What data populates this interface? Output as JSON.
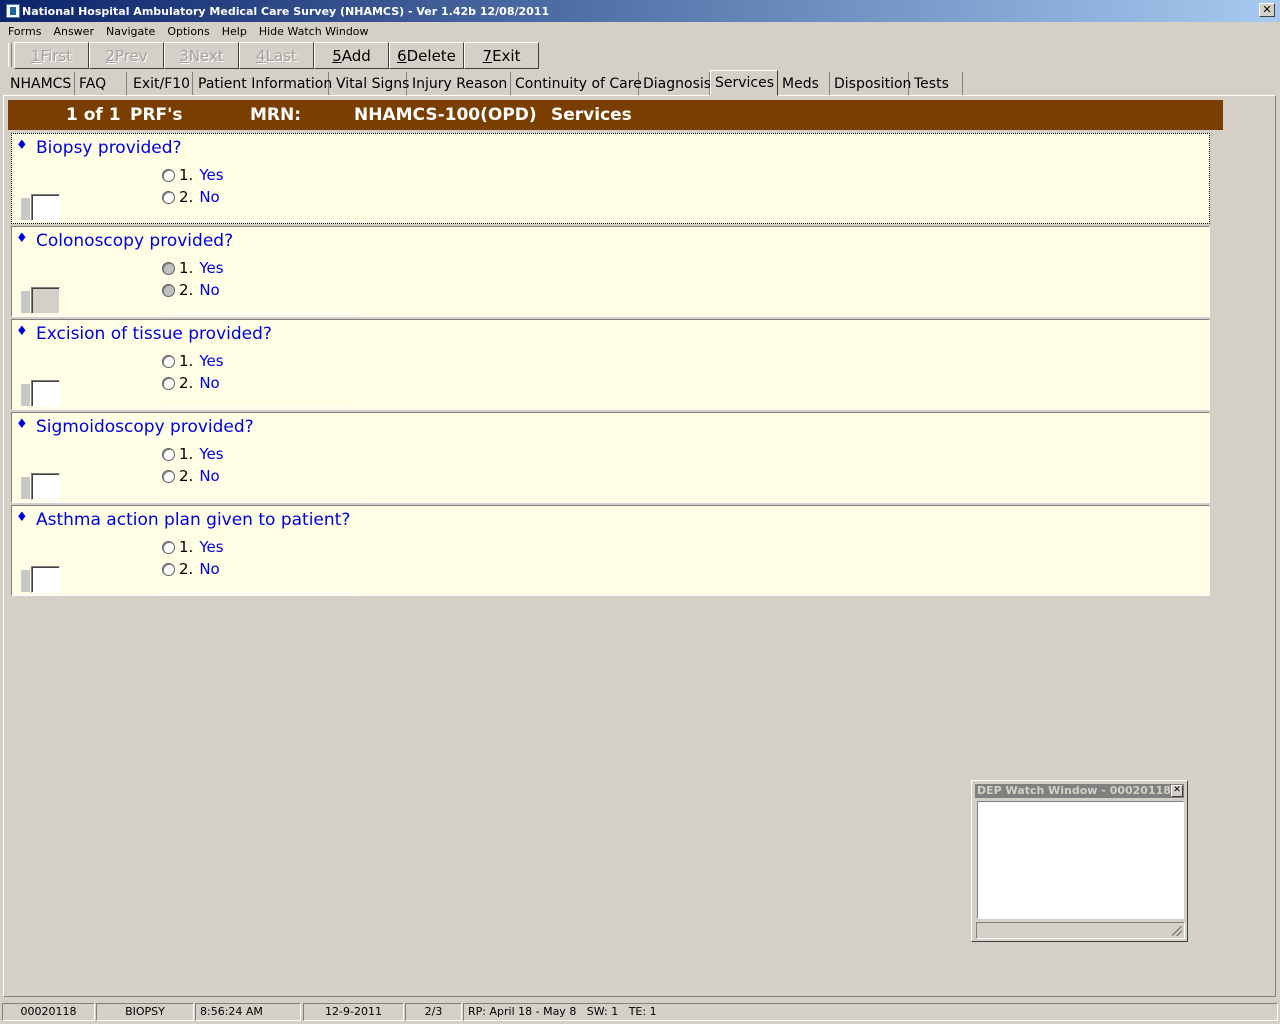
{
  "window": {
    "title": "National Hospital Ambulatory Medical Care Survey (NHAMCS) - Ver 1.42b 12/08/2011",
    "close": "✕"
  },
  "menu": [
    "Forms",
    "Answer",
    "Navigate",
    "Options",
    "Help",
    "Hide Watch Window"
  ],
  "toolbar": {
    "buttons": [
      {
        "key": "1",
        "label": " First"
      },
      {
        "key": "2",
        "label": " Prev"
      },
      {
        "key": "3",
        "label": " Next"
      },
      {
        "key": "4",
        "label": " Last"
      },
      {
        "key": "5",
        "label": " Add"
      },
      {
        "key": "6",
        "label": " Delete"
      },
      {
        "key": "7",
        "label": " Exit"
      }
    ]
  },
  "tabs": [
    "NHAMCS",
    "FAQ",
    "Exit/F10",
    "Patient Information",
    "Vital Signs",
    "Injury Reason",
    "Continuity of Care",
    "Diagnosis",
    "Services",
    "Meds",
    "Disposition",
    "Tests"
  ],
  "active_tab": "Services",
  "header": {
    "count": "1 of 1",
    "prf": "PRF's",
    "mrn": "MRN:",
    "form": "NHAMCS-100(OPD)",
    "section": "Services"
  },
  "questions": [
    {
      "text": "Biopsy provided?",
      "options": [
        {
          "num": "1.",
          "label": "Yes"
        },
        {
          "num": "2.",
          "label": "No"
        }
      ]
    },
    {
      "text": "Colonoscopy provided?",
      "options": [
        {
          "num": "1.",
          "label": "Yes"
        },
        {
          "num": "2.",
          "label": "No"
        }
      ]
    },
    {
      "text": "Excision of tissue provided?",
      "options": [
        {
          "num": "1.",
          "label": "Yes"
        },
        {
          "num": "2.",
          "label": "No"
        }
      ]
    },
    {
      "text": "Sigmoidoscopy provided?",
      "options": [
        {
          "num": "1.",
          "label": "Yes"
        },
        {
          "num": "2.",
          "label": "No"
        }
      ]
    },
    {
      "text": "Asthma action plan given to patient?",
      "options": [
        {
          "num": "1.",
          "label": "Yes"
        },
        {
          "num": "2.",
          "label": "No"
        }
      ]
    }
  ],
  "bullet": "♦",
  "watch": {
    "title": "DEP Watch Window - 00020118",
    "close": "✕"
  },
  "status": {
    "case_id": "00020118",
    "field": "BIOPSY",
    "time": "8:56:24 AM",
    "date": "12-9-2011",
    "page": "2/3",
    "info": "RP: April 18 - May 8   SW: 1   TE: 1"
  }
}
